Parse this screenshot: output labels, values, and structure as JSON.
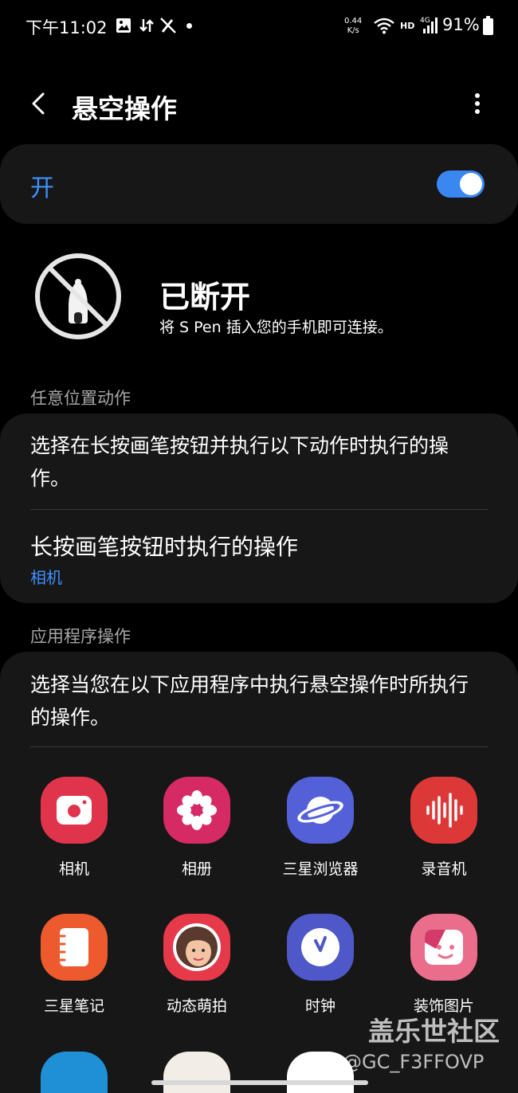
{
  "status_bar": {
    "time": "下午11:02",
    "net_speed_value": "0.44",
    "net_speed_unit": "K/s",
    "hd_label": "HD",
    "signal_label": "4G",
    "battery": "91%",
    "icons": [
      "gallery-icon",
      "data-transfer-icon",
      "spen-off-icon",
      "dot-icon",
      "wifi-icon",
      "signal-icon",
      "battery-icon"
    ]
  },
  "app_bar": {
    "title": "悬空操作"
  },
  "master_switch": {
    "label": "开",
    "on": true
  },
  "pen_status": {
    "state": "已断开",
    "hint": "将 S Pen 插入您的手机即可连接。"
  },
  "anywhere_actions": {
    "header": "任意位置动作",
    "description": "选择在长按画笔按钮并执行以下动作时执行的操作。",
    "row_title": "长按画笔按钮时执行的操作",
    "row_value": "相机"
  },
  "app_actions": {
    "header": "应用程序操作",
    "description": "选择当您在以下应用程序中执行悬空操作时所执行的操作。",
    "apps": [
      {
        "label": "相机",
        "icon": "camera-icon",
        "color": "#e0344c"
      },
      {
        "label": "相册",
        "icon": "gallery-flower-icon",
        "color": "#d52a63"
      },
      {
        "label": "三星浏览器",
        "icon": "browser-planet-icon",
        "color": "#5360d8"
      },
      {
        "label": "录音机",
        "icon": "voice-recorder-icon",
        "color": "#dd3838"
      },
      {
        "label": "三星笔记",
        "icon": "samsung-notes-icon",
        "color": "#ec5a2e"
      },
      {
        "label": "动态萌拍",
        "icon": "ar-emoji-icon",
        "color": "#e6394a"
      },
      {
        "label": "时钟",
        "icon": "clock-icon",
        "color": "#4f58c8"
      },
      {
        "label": "装饰图片",
        "icon": "photo-decor-icon",
        "color": "#ea6d8c"
      }
    ]
  },
  "watermark": {
    "line1": "盖乐世社区",
    "line2": "@GC_F3FFOVP"
  },
  "colors": {
    "accent": "#3e91ff",
    "card": "#171717",
    "background": "#000000"
  }
}
